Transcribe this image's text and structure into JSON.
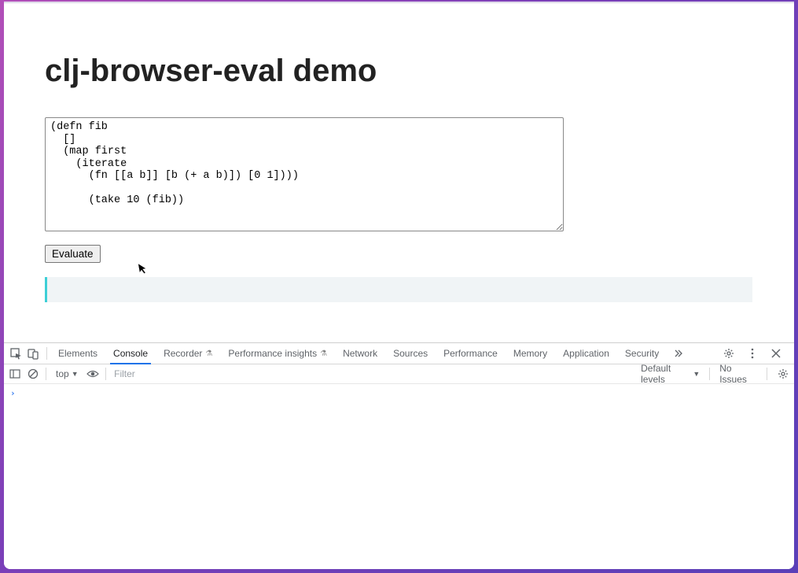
{
  "page": {
    "title": "clj-browser-eval demo",
    "code": "(defn fib\n  []\n  (map first\n    (iterate\n      (fn [[a b]] [b (+ a b)]) [0 1])))\n\n      (take 10 (fib))",
    "evaluate_label": "Evaluate",
    "output": ""
  },
  "devtools": {
    "tabs": {
      "elements": "Elements",
      "console": "Console",
      "recorder": "Recorder",
      "perf_insights": "Performance insights",
      "network": "Network",
      "sources": "Sources",
      "performance": "Performance",
      "memory": "Memory",
      "application": "Application",
      "security": "Security"
    },
    "active_tab": "Console",
    "console": {
      "context": "top",
      "filter_placeholder": "Filter",
      "filter_value": "",
      "levels_label": "Default levels",
      "issues_label": "No Issues",
      "prompt": "›"
    }
  }
}
